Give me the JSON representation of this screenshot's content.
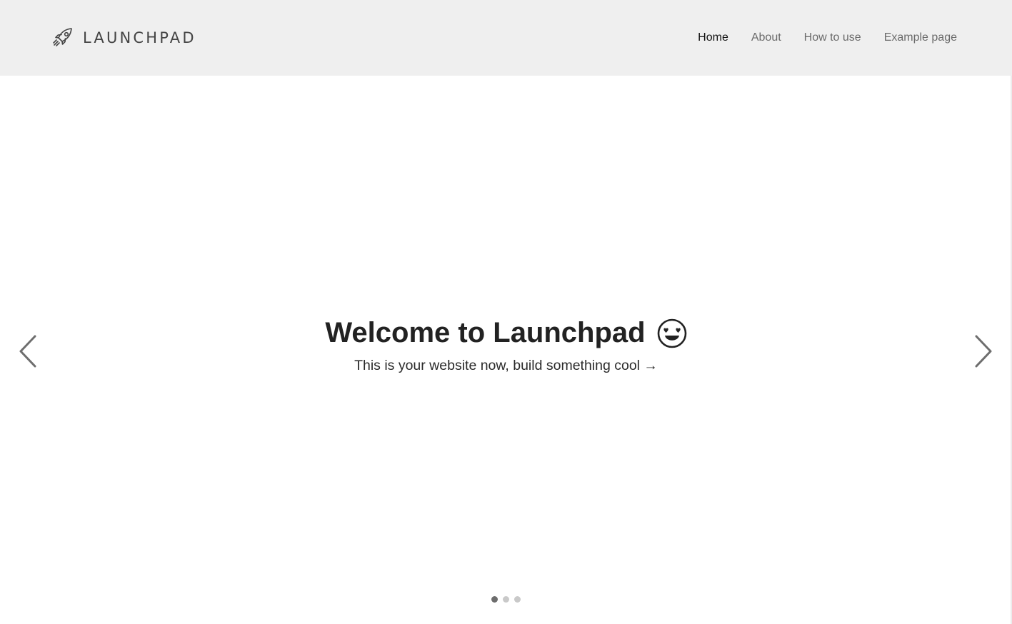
{
  "brand": {
    "name": "LAUNCHPAD",
    "logo_icon": "rocket-icon"
  },
  "nav": {
    "items": [
      {
        "label": "Home",
        "active": true
      },
      {
        "label": "About",
        "active": false
      },
      {
        "label": "How to use",
        "active": false
      },
      {
        "label": "Example page",
        "active": false
      }
    ]
  },
  "hero": {
    "title": "Welcome to Launchpad",
    "title_emoji": "heart-eyes-face-icon",
    "subtitle": "This is your website now, build something cool →"
  },
  "carousel": {
    "prev_icon": "chevron-left-icon",
    "next_icon": "chevron-right-icon",
    "slide_count": 3,
    "active_slide": 1
  },
  "colors": {
    "navbar_bg": "#efefef",
    "nav_text": "#6a6a6a",
    "nav_active": "#111111",
    "title_text": "#222222",
    "dot_active": "#6d6d6d",
    "dot_inactive": "#c9c9c9"
  }
}
